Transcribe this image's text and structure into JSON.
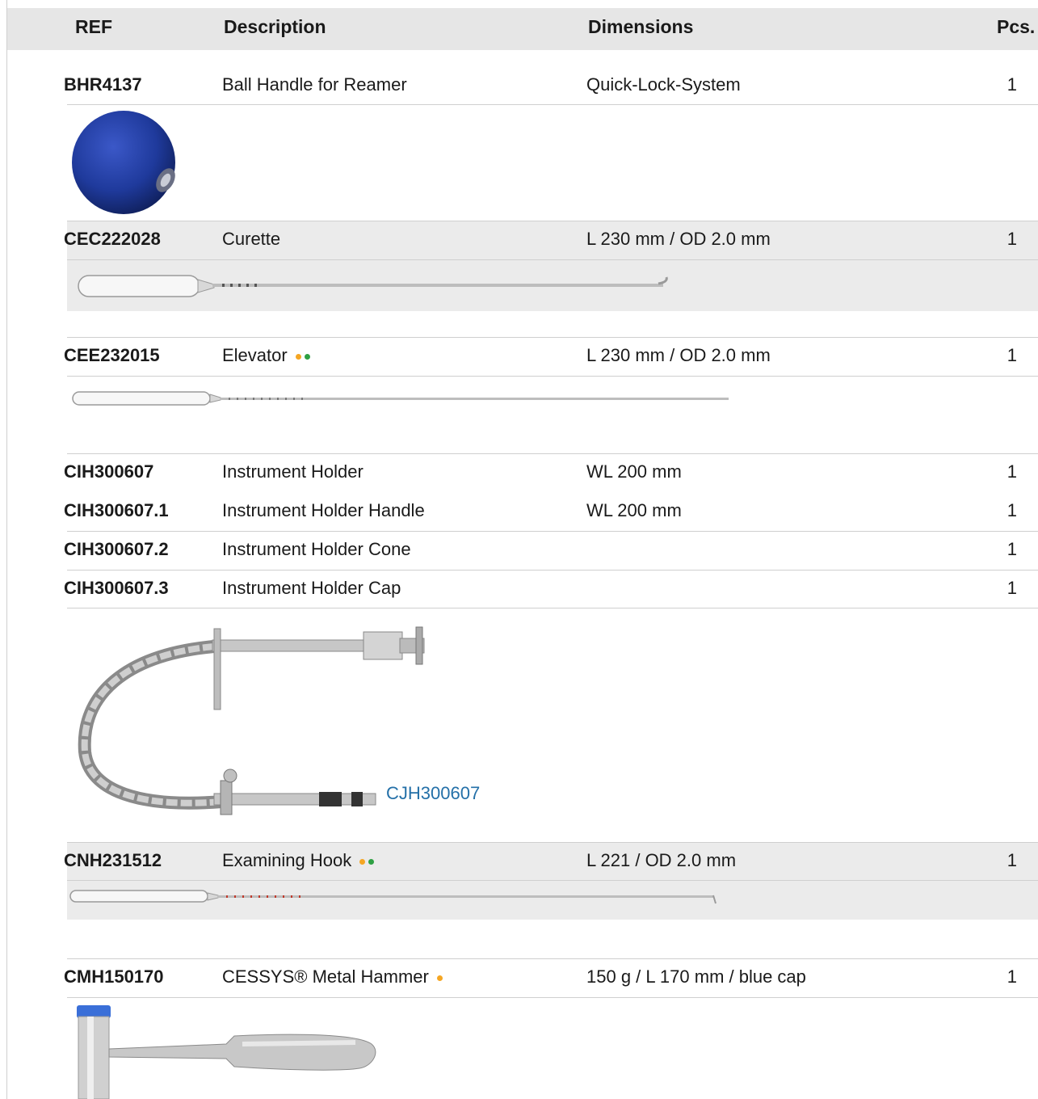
{
  "header": {
    "ref": "REF",
    "description": "Description",
    "dimensions": "Dimensions",
    "pcs": "Pcs."
  },
  "rows": [
    {
      "ref": "BHR4137",
      "description": "Ball Handle for Reamer",
      "dimensions": "Quick-Lock-System",
      "pcs": "1"
    },
    {
      "ref": "CEC222028",
      "description": "Curette",
      "dimensions": "L 230 mm / OD 2.0 mm",
      "pcs": "1"
    },
    {
      "ref": "CEE232015",
      "description": "Elevator",
      "dimensions": "L 230 mm / OD 2.0 mm",
      "pcs": "1"
    },
    {
      "ref": "CIH300607",
      "description": "Instrument Holder",
      "dimensions": "WL 200 mm",
      "pcs": "1"
    },
    {
      "ref": "CIH300607.1",
      "description": "Instrument Holder Handle",
      "dimensions": "WL 200 mm",
      "pcs": "1"
    },
    {
      "ref": "CIH300607.2",
      "description": "Instrument Holder Cone",
      "dimensions": "",
      "pcs": "1"
    },
    {
      "ref": "CIH300607.3",
      "description": "Instrument Holder Cap",
      "dimensions": "",
      "pcs": "1"
    },
    {
      "ref": "CNH231512",
      "description": "Examining Hook",
      "dimensions": "L 221 / OD 2.0 mm",
      "pcs": "1"
    },
    {
      "ref": "CMH150170",
      "description": "CESSYS® Metal Hammer",
      "dimensions": "150 g / L 170 mm / blue cap",
      "pcs": "1"
    }
  ],
  "holder_link": "CJH300607",
  "colors": {
    "dot_orange": "#f5a623",
    "dot_green": "#2ea043",
    "ball_blue": "#1f3a9c",
    "link_blue": "#2470a8"
  },
  "icons": [
    "ball-handle-image",
    "curette-image",
    "elevator-image",
    "instrument-holder-image",
    "examining-hook-image",
    "metal-hammer-image"
  ]
}
